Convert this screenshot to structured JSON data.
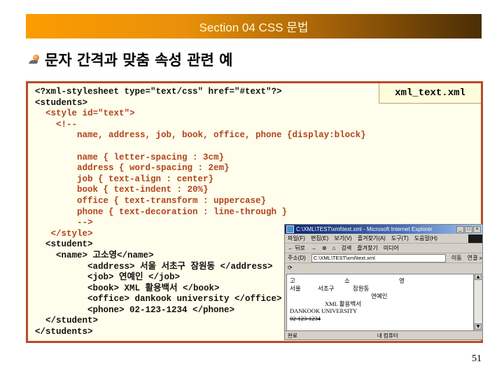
{
  "header": {
    "section_title": "Section 04 CSS 문법"
  },
  "slide": {
    "title": "문자 간격과 맞춤 속성 관련 예",
    "page_number": "51"
  },
  "code_box": {
    "file_label": "xml_text.xml",
    "lines": [
      {
        "text": "<?xml-stylesheet type=\"text/css\" href=\"#text\"?>",
        "color": "black"
      },
      {
        "text": "<students>",
        "color": "black"
      },
      {
        "text": "  <style id=\"text\">",
        "color": "red"
      },
      {
        "text": "    <!--",
        "color": "red"
      },
      {
        "text": "        name, address, job, book, office, phone {display:block}",
        "color": "red"
      },
      {
        "text": "",
        "color": "red"
      },
      {
        "text": "        name { letter-spacing : 3cm}",
        "color": "red"
      },
      {
        "text": "        address { word-spacing : 2em}",
        "color": "red"
      },
      {
        "text": "        job { text-align : center}",
        "color": "red"
      },
      {
        "text": "        book { text-indent : 20%}",
        "color": "red"
      },
      {
        "text": "        office { text-transform : uppercase}",
        "color": "red"
      },
      {
        "text": "        phone { text-decoration : line-through }",
        "color": "red"
      },
      {
        "text": "        -->",
        "color": "red"
      },
      {
        "text": "   </style>",
        "color": "red"
      },
      {
        "text": "  <student>",
        "color": "black"
      },
      {
        "text": "    <name> 고소영</name>",
        "color": "black"
      },
      {
        "text": "          <address> 서울 서초구 잠원동 </address>",
        "color": "black"
      },
      {
        "text": "          <job> 연예인 </job>",
        "color": "black"
      },
      {
        "text": "          <book> XML 활용백서 </book>",
        "color": "black"
      },
      {
        "text": "          <office> dankook university </office>",
        "color": "black"
      },
      {
        "text": "          <phone> 02-123-1234 </phone>",
        "color": "black"
      },
      {
        "text": "  </student>",
        "color": "black"
      },
      {
        "text": "</students>",
        "color": "black"
      }
    ]
  },
  "browser": {
    "title": "C:\\XML\\TEST\\xml\\text.xml - Microsoft Internet Explorer",
    "window_buttons": [
      "_",
      "□",
      "×"
    ],
    "menu": [
      "파일(F)",
      "편집(E)",
      "보기(V)",
      "즐겨찾기(A)",
      "도구(T)",
      "도움말(H)"
    ],
    "toolbar": [
      "← 뒤로",
      "→",
      "⊗",
      "⌂",
      "검색",
      "즐겨찾기",
      "미디어"
    ],
    "address_label": "주소(D)",
    "address_value": "C:\\XML\\TEST\\xml\\text.xml",
    "go_label": "이동",
    "links_label": "연결 »",
    "content": {
      "name_row": [
        "고",
        "소",
        "영"
      ],
      "address_row": [
        "서울",
        "서초구",
        "잠원동"
      ],
      "job": "연예인",
      "book": "XML 활용백서",
      "office": "DANKOOK UNIVERSITY",
      "phone": "02-123-1234"
    },
    "status_left": "완료",
    "status_right": "내 컴퓨터"
  },
  "colors": {
    "code_black": "#111111",
    "code_red": "#b0441c",
    "box_border": "#b94a28",
    "box_bg": "#fffdeb"
  }
}
